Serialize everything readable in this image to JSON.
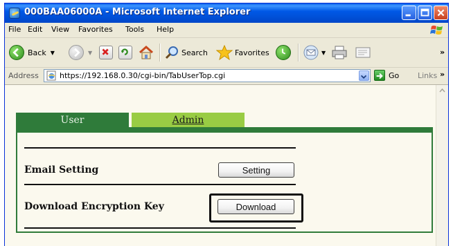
{
  "window": {
    "title": "000BAA06000A - Microsoft Internet Explorer"
  },
  "menubar": {
    "items": [
      "File",
      "Edit",
      "View",
      "Favorites",
      "Tools",
      "Help"
    ]
  },
  "toolbar": {
    "back_label": "Back",
    "search_label": "Search",
    "favorites_label": "Favorites"
  },
  "address": {
    "label": "Address",
    "url": "https://192.168.0.30/cgi-bin/TabUserTop.cgi",
    "go_label": "Go",
    "links_label": "Links"
  },
  "page": {
    "tabs": [
      {
        "label": "User",
        "active": true
      },
      {
        "label": "Admin",
        "active": false
      }
    ],
    "rows": [
      {
        "label": "Email Setting",
        "button": "Setting"
      },
      {
        "label": "Download Encryption Key",
        "button": "Download",
        "highlighted": true
      }
    ]
  },
  "colors": {
    "tab_active": "#2f7b3a",
    "tab_inactive": "#99cc44",
    "titlebar": "#0058e6"
  }
}
